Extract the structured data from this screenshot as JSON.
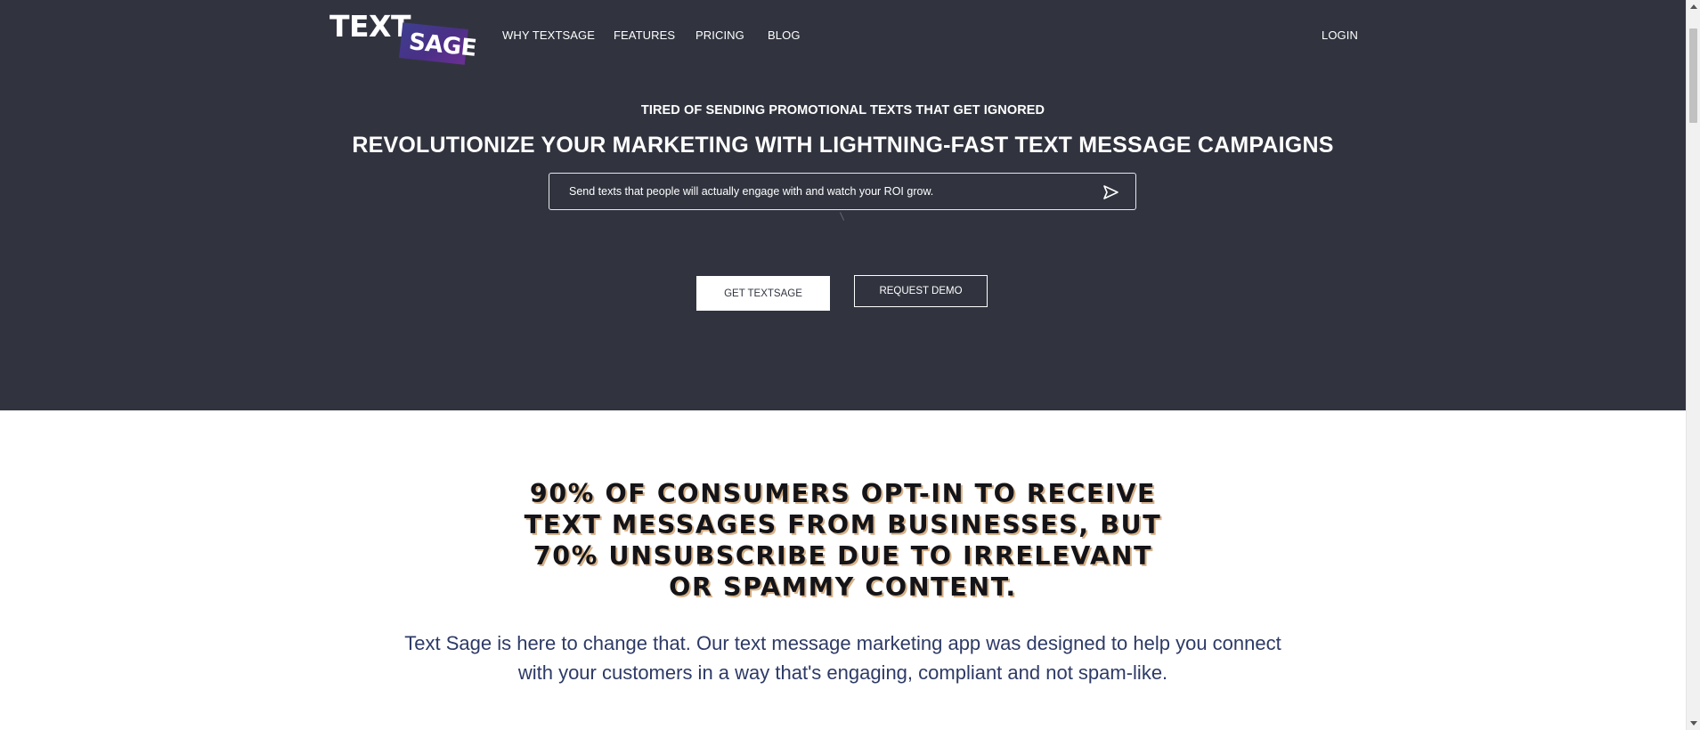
{
  "logo": {
    "word_top": "TEXT",
    "word_badge": "SAGE"
  },
  "nav": {
    "items": [
      {
        "label": "WHY TEXTSAGE"
      },
      {
        "label": "FEATURES"
      },
      {
        "label": "PRICING"
      },
      {
        "label": "BLOG"
      }
    ],
    "login_label": "LOGIN"
  },
  "hero": {
    "eyebrow": "TIRED OF SENDING PROMOTIONAL TEXTS THAT GET IGNORED",
    "headline": "REVOLUTIONIZE YOUR MARKETING WITH LIGHTNING-FAST TEXT MESSAGE CAMPAIGNS",
    "message_box_text": "Send texts that people will actually engage with and watch your ROI grow.",
    "send_icon": "send-icon",
    "get_button": "GET TEXTSAGE",
    "demo_button": "REQUEST DEMO"
  },
  "stats": {
    "heading_lines": [
      "90% OF CONSUMERS OPT-IN TO RECEIVE",
      "TEXT MESSAGES FROM BUSINESSES, BUT",
      "70% UNSUBSCRIBE DUE TO IRRELEVANT",
      "OR SPAMMY CONTENT."
    ],
    "body_lines": [
      "Text Sage is here to change that. Our text message marketing app was designed to help you connect",
      "with your customers in a way that's engaging, compliant and not spam-like."
    ]
  },
  "colors": {
    "hero_bg": "#31343f",
    "logo_badge": "#4b2f86",
    "heading_text": "#141418",
    "heading_shadow": "#d7b28a",
    "body_text": "#2d3a66"
  }
}
